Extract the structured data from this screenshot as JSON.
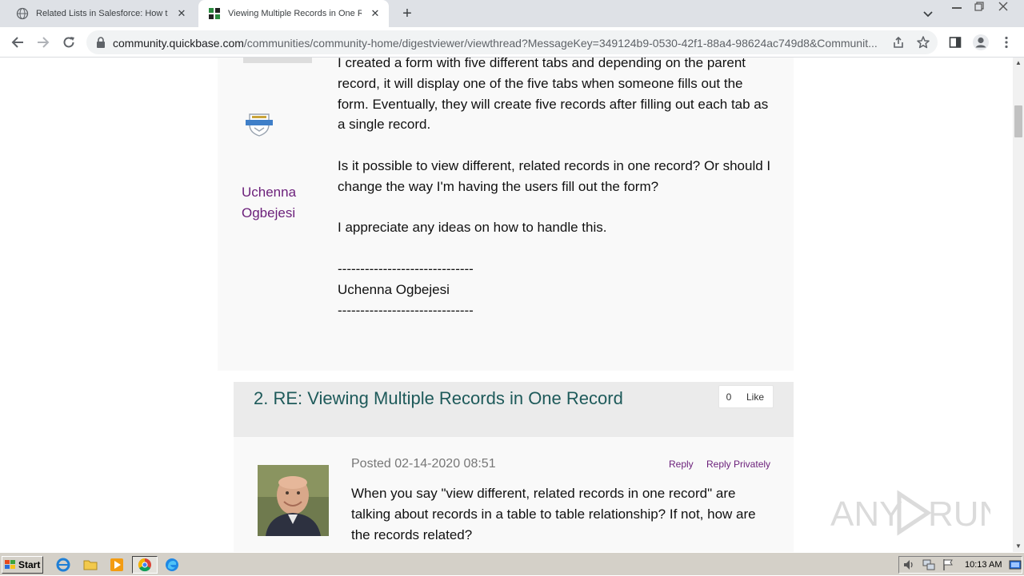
{
  "browser": {
    "tabs": [
      {
        "title": "Related Lists in Salesforce: How to S",
        "active": false
      },
      {
        "title": "Viewing Multiple Records in One Rec",
        "active": true
      }
    ],
    "new_tab_symbol": "+",
    "close_symbol": "✕",
    "window_controls": [
      "minimize",
      "restore",
      "close"
    ],
    "url_host": "community.quickbase.com",
    "url_path": "/communities/community-home/digestviewer/viewthread?MessageKey=349124b9-0530-42f1-88a4-98624ac749d8&Communit..."
  },
  "thread": {
    "original_post": {
      "author_line1": "Uchenna",
      "author_line2": "Ogbejesi",
      "paragraphs": [
        "I created a form with five different tabs and depending on the parent record, it will display one of the five tabs when someone fills out the form. Eventually, they will create five records after filling out each tab as a single record.",
        "Is it possible to view different, related records in one record? Or should I change the way I'm having the users fill out the form?",
        "I appreciate any ideas on how to handle this."
      ],
      "signature_divider": "------------------------------",
      "signature_name": "Uchenna Ogbejesi"
    },
    "reply": {
      "title": "2.  RE: Viewing Multiple Records in One Record",
      "like_count": "0",
      "like_label": "Like",
      "posted": "Posted 02-14-2020 08:51",
      "reply_label": "Reply",
      "reply_privately_label": "Reply Privately",
      "body": "When you say \"view different, related records in one record\" are talking about records in a table to table relationship? If not, how are the records related?"
    }
  },
  "watermark_text": "ANY RUN",
  "taskbar": {
    "start_label": "Start",
    "clock": "10:13 AM"
  },
  "colors": {
    "author_link": "#6b1f7a",
    "reply_title": "#1e5a5a",
    "post_background": "#f9f9f9",
    "reply_header_background": "#ebebeb"
  }
}
